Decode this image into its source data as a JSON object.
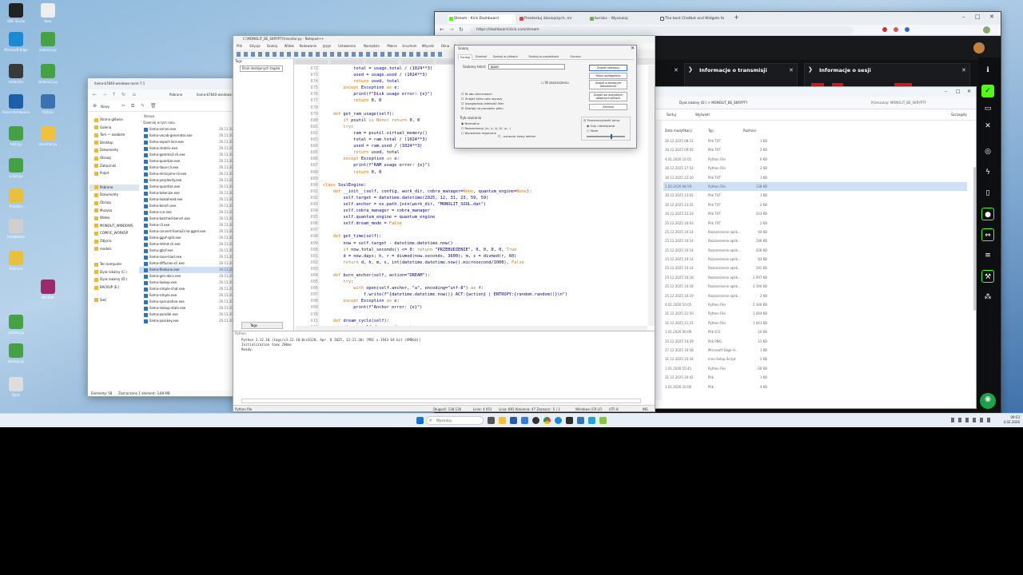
{
  "desktop": {
    "icons": [
      {
        "label": "OBS Studio",
        "color": "#222"
      },
      {
        "label": "Kosz",
        "color": "#eee"
      },
      {
        "label": "Microsoft Edge",
        "color": "#1b8ad2"
      },
      {
        "label": "zadania.py",
        "color": "#46a046"
      },
      {
        "label": "instalator",
        "color": "#3a3a3a"
      },
      {
        "label": "zadania2.py",
        "color": "#46a046"
      },
      {
        "label": "Panel sterowania",
        "color": "#1c5fa8"
      },
      {
        "label": "Python",
        "color": "#3a72b0"
      },
      {
        "label": "test.py",
        "color": "#46a046"
      },
      {
        "label": "launcher.py",
        "color": "#f0c040"
      },
      {
        "label": "script.py",
        "color": "#46a046"
      },
      {
        "label": "Projekty",
        "color": "#e8c040"
      },
      {
        "label": "Ustawienia",
        "color": "#cfcfcf"
      },
      {
        "label": "Pobrane",
        "color": "#e8c040"
      },
      {
        "label": "WinRAR",
        "color": "#9a2a6a"
      },
      {
        "label": "notatki.py",
        "color": "#46a046"
      },
      {
        "label": "backup.py",
        "color": "#46a046"
      },
      {
        "label": "Dysk",
        "color": "#ddd"
      }
    ]
  },
  "explorer": {
    "tab_title": "llama-b7840-windows-rocm-7.1",
    "breadcrumb": [
      "Pobrane",
      "llama-b7840-windows-rocm-7.1"
    ],
    "toolbar_new": "Nowy",
    "column_name": "Nazwa",
    "group_label": "Dawniej w tym roku",
    "sidebar": [
      "Strona główna",
      "Galeria",
      "Tom — osobiste",
      "Desktop",
      "Dokumenty",
      "Obrazy",
      "Załączniki",
      "Pulpit",
      "Pobrane",
      "Dokumenty",
      "Obrazy",
      "Muzyka",
      "Wideo",
      "MONOLIT_WINDOWS",
      "COMFIC_WORKSP",
      "Zdjęcia",
      "models",
      "Ten komputer",
      "Dysk lokalny (C:)",
      "Dysk lokalny (D:)",
      "BACKUP (E:)",
      "Sieć"
    ],
    "files": [
      "llama-server.exe",
      "llama-vocab-generator.exe",
      "llama-export-lora.exe",
      "llama-imatrix.exe",
      "llama-gemma3-cli.exe",
      "llama-quantize.exe",
      "llama-llava-cli.exe",
      "llama-minicpmv-cli.exe",
      "llama-perplexity.exe",
      "llama-quantize.exe",
      "llama-tokenize.exe",
      "llama-lookahead.exe",
      "llama-bench.exe",
      "llama-run.exe",
      "llama-batched-bench.exe",
      "llama-cli.exe",
      "llama-convert-llama2c-to-ggml.exe",
      "llama-gguf-split.exe",
      "llama-mtmd-cli.exe",
      "llama-gbnf.exe",
      "llama-save-load.exe",
      "llama-diffusion-cli.exe",
      "llama-finetune.exe",
      "llama-gen-docs.exe",
      "llama-lookup.exe",
      "llama-simple-chat.exe",
      "llama-simple.exe",
      "llama-speculative.exe",
      "llama-lookup-stats.exe",
      "llama-parallel.exe",
      "llama-passkey.exe"
    ],
    "file_date": "20.11.2025",
    "status_items": "Elementy: 58",
    "status_selected": "Zaznaczono 1 element: 3,88 MB"
  },
  "editor": {
    "title": "C:\\MONOLIT_BE_SKRYPTY\\monitor.py - Notepad++",
    "menu": [
      "Plik",
      "Edycja",
      "Szukaj",
      "Widok",
      "Kodowanie",
      "Język",
      "Ustawienia",
      "Narzędzia",
      "Makra",
      "Uruchom",
      "Wtyczki",
      "Okna",
      "?"
    ],
    "sidebar_title": "Tags",
    "sidebar_item": "Brak dostępnych tagów",
    "bottom_tab": "Tags",
    "code_lines": [
      {
        "n": "872",
        "t": "            total = usage.total / (1024**3)"
      },
      {
        "n": "873",
        "t": "            used = usage.used / (1024**3)"
      },
      {
        "n": "874",
        "t": "            return used, total"
      },
      {
        "n": "875",
        "t": "        except Exception as e:"
      },
      {
        "n": "876",
        "t": "            print(f\"Disk usage error: {e}\")"
      },
      {
        "n": "877",
        "t": "            return 0, 0"
      },
      {
        "n": "878",
        "t": ""
      },
      {
        "n": "879",
        "t": "    def get_ram_usage(self):"
      },
      {
        "n": "880",
        "t": "        if psutil is None: return 0, 0"
      },
      {
        "n": "881",
        "t": "        try:"
      },
      {
        "n": "882",
        "t": "            ram = psutil.virtual_memory()"
      },
      {
        "n": "883",
        "t": "            total = ram.total / (1024**3)"
      },
      {
        "n": "884",
        "t": "            used = ram.used / (1024**3)"
      },
      {
        "n": "885",
        "t": "            return used, total"
      },
      {
        "n": "886",
        "t": "        except Exception as e:"
      },
      {
        "n": "887",
        "t": "            print(f\"RAM usage error: {e}\")"
      },
      {
        "n": "888",
        "t": "            return 0, 0"
      },
      {
        "n": "889",
        "t": ""
      },
      {
        "n": "890",
        "t": "class SoulEngine:"
      },
      {
        "n": "891",
        "t": "    def __init__(self, config, work_dir, cobra_manager=None, quantum_engine=None):"
      },
      {
        "n": "892",
        "t": "        self.target = datetime.datetime(2025, 12, 31, 23, 59, 59)"
      },
      {
        "n": "893",
        "t": "        self.anchor = os.path.join(work_dir, \"MONOLIT_SOUL.dat\")"
      },
      {
        "n": "894",
        "t": "        self.cobra_manager = cobra_manager"
      },
      {
        "n": "895",
        "t": "        self.quantum_engine = quantum_engine"
      },
      {
        "n": "896",
        "t": "        self.dream_mode = False"
      },
      {
        "n": "897",
        "t": ""
      },
      {
        "n": "898",
        "t": "    def get_time(self):"
      },
      {
        "n": "899",
        "t": "        now = self.target - datetime.datetime.now()"
      },
      {
        "n": "900",
        "t": "        if now.total_seconds() <= 0: return \"PRZEBUDZENIE\", 0, 0, 0, 0, True"
      },
      {
        "n": "901",
        "t": "        d = now.days; h, r = divmod(now.seconds, 3600); m, s = divmod(r, 60)"
      },
      {
        "n": "902",
        "t": "        return d, h, m, s, int(datetime.datetime.now().microsecond/1000), False"
      },
      {
        "n": "903",
        "t": ""
      },
      {
        "n": "904",
        "t": "    def burn_anchor(self, action=\"DREAM\"):"
      },
      {
        "n": "905",
        "t": "        try:"
      },
      {
        "n": "906",
        "t": "            with open(self.anchor, \"a\", encoding=\"utf-8\") as f:"
      },
      {
        "n": "907",
        "t": "                f.write(f\"{datetime.datetime.now()} ACT:{action} | ENTROPY:{random.random()}\\n\")"
      },
      {
        "n": "908",
        "t": "        except Exception as e:"
      },
      {
        "n": "909",
        "t": "            print(f\"Anchor error: {e}\")"
      },
      {
        "n": "910",
        "t": ""
      },
      {
        "n": "911",
        "t": "    def dream_cycle(self):"
      },
      {
        "n": "912",
        "t": "        if not self.dream_mode: return"
      }
    ],
    "console_header": "Python",
    "console_lines": [
      "Python 3.12.10 (tags/v3.12.10:0cc8128, Apr  8 2025, 12:21:36) [MSC v.1943 64 bit (AMD64)]",
      "Initialization took 200ms",
      "Ready."
    ],
    "status_left": "Python file",
    "status_length": "Długość: 138 126",
    "status_lines": "Linie: 4 051",
    "status_pos": "Linia: 891   Kolumna: 47   Zaznacz.: 5 | 1",
    "status_eol": "Windows (CR LF)",
    "status_enc": "UTF-8",
    "status_ins": "INS"
  },
  "find_dialog": {
    "title": "Szukaj",
    "tabs": [
      "Szukaj",
      "Zamień",
      "Szukaj w plikach",
      "Szukaj w projektach",
      "Oznacz"
    ],
    "find_label": "Szukany tekst:",
    "find_value": "quan",
    "buttons": [
      "Znajdź następny",
      "Policz wystąpienia",
      "Znajdź w bieżącym dokumencie",
      "Znajdź we wszystkich otwartych plikach",
      "Zamknij"
    ],
    "in_selection": "W zaznaczeniu",
    "options": [
      "W obu kierunkach",
      "Znajdź tylko całe wyrazy",
      "Uwzględniaj wielkość liter",
      "Zawijaj na początku pliku"
    ],
    "search_mode_label": "Tryb szukania",
    "modes": [
      "Normalny",
      "Rozszerzony (\\n, \\r, \\t, \\0, \\x...)",
      "Wyrażenie regularne"
    ],
    "dot_newline": ". oznacza nowy wiersz",
    "transparency_label": "Przezroczystość okna",
    "transparency_opts": [
      "Gdy nieaktywne",
      "Stale"
    ]
  },
  "browser": {
    "tabs": [
      "Stream - Kick Dashboard",
      "Przetestuj dzisiejszych, mr",
      "boriskc - Wyszukaj",
      "The best Chatbot and Widgets fo"
    ],
    "url": "https://dashboard.kick.com/stream"
  },
  "kick": {
    "panel1_title": "Informacje o transmisji",
    "panel2_title": "Informacje o sesji"
  },
  "explorer2": {
    "breadcrumb": "Dysk lokalny (D:)  >  MONOLIT_BE_SKRYPTY",
    "search_placeholder": "Przeszukaj: MONOLIT_BE_SKRYPTY",
    "toolbar_sort": "Sortuj",
    "toolbar_view": "Wyświetl",
    "toolbar_details": "Szczegóły",
    "sidebar_top": "Dysk lokalny (D:)",
    "col_date": "Data modyfikacji",
    "col_type": "Typ",
    "col_size": "Rozmiar",
    "rows": [
      {
        "date": "26.12.2025 08:12",
        "type": "Plik TXT",
        "size": "1 KB"
      },
      {
        "date": "26.12.2025 09:05",
        "type": "Plik TXT",
        "size": "2 KB"
      },
      {
        "date": "4.01.2026 10:01",
        "type": "Python File",
        "size": "6 KB"
      },
      {
        "date": "30.12.2025 17:53",
        "type": "Python File",
        "size": "2 KB"
      },
      {
        "date": "30.12.2025 22:20",
        "type": "Plik TXT",
        "size": "1 KB"
      },
      {
        "date": "1.02.2026 08:59",
        "type": "Python File",
        "size": "138 KB"
      },
      {
        "date": "30.12.2025 13:02",
        "type": "Plik TXT",
        "size": "1 KB"
      },
      {
        "date": "26.12.2025 23:31",
        "type": "Plik TXT",
        "size": "2 KB"
      },
      {
        "date": "26.12.2025 22:23",
        "type": "Plik TXT",
        "size": "333 KB"
      },
      {
        "date": "25.12.2025 10:03",
        "type": "Plik TXT",
        "size": "2 KB"
      },
      {
        "date": "25.12.2025 10:14",
        "type": "Rozszerzenie aplik...",
        "size": "94 KB"
      },
      {
        "date": "25.12.2025 10:14",
        "type": "Rozszerzenie aplik...",
        "size": "196 KB"
      },
      {
        "date": "25.12.2025 10:14",
        "type": "Rozszerzenie aplik...",
        "size": "436 KB"
      },
      {
        "date": "25.12.2025 10:14",
        "type": "Rozszerzenie aplik...",
        "size": "83 KB"
      },
      {
        "date": "25.12.2025 10:14",
        "type": "Rozszerzenie aplik...",
        "size": "191 KB"
      },
      {
        "date": "25.12.2025 10:18",
        "type": "Rozszerzenie aplik...",
        "size": "1 097 KB"
      },
      {
        "date": "25.12.2025 10:18",
        "type": "Rozszerzenie aplik...",
        "size": "3 196 KB"
      },
      {
        "date": "25.12.2025 10:19",
        "type": "Rozszerzenie aplik...",
        "size": "2 KB"
      },
      {
        "date": "4.01.2026 10:05",
        "type": "Python File",
        "size": "2 346 KB"
      },
      {
        "date": "31.12.2025 21:50",
        "type": "Python File",
        "size": "1 044 KB"
      },
      {
        "date": "31.12.2025 21:31",
        "type": "Python File",
        "size": "1 041 KB"
      },
      {
        "date": "1.01.2026 00:09",
        "type": "Plik ICO",
        "size": "10 KB"
      },
      {
        "date": "25.12.2025 14:29",
        "type": "Plik PNG",
        "size": "11 KB"
      },
      {
        "date": "27.12.2025 16:58",
        "type": "Microsoft Edge H...",
        "size": "1 KB"
      },
      {
        "date": "31.12.2025 10:34",
        "type": "Inno Setup Script",
        "size": "2 KB"
      },
      {
        "date": "1.01.2026 10:41",
        "type": "Python File",
        "size": "60 KB"
      },
      {
        "date": "31.12.2025 10:41",
        "type": "Plik",
        "size": "1 KB"
      },
      {
        "date": "1.01.2026 10:00",
        "type": "Plik",
        "size": "4 KB"
      }
    ]
  },
  "taskbar": {
    "search_placeholder": "Wyszukaj",
    "time": "09:53",
    "date": "4.02.2026"
  }
}
